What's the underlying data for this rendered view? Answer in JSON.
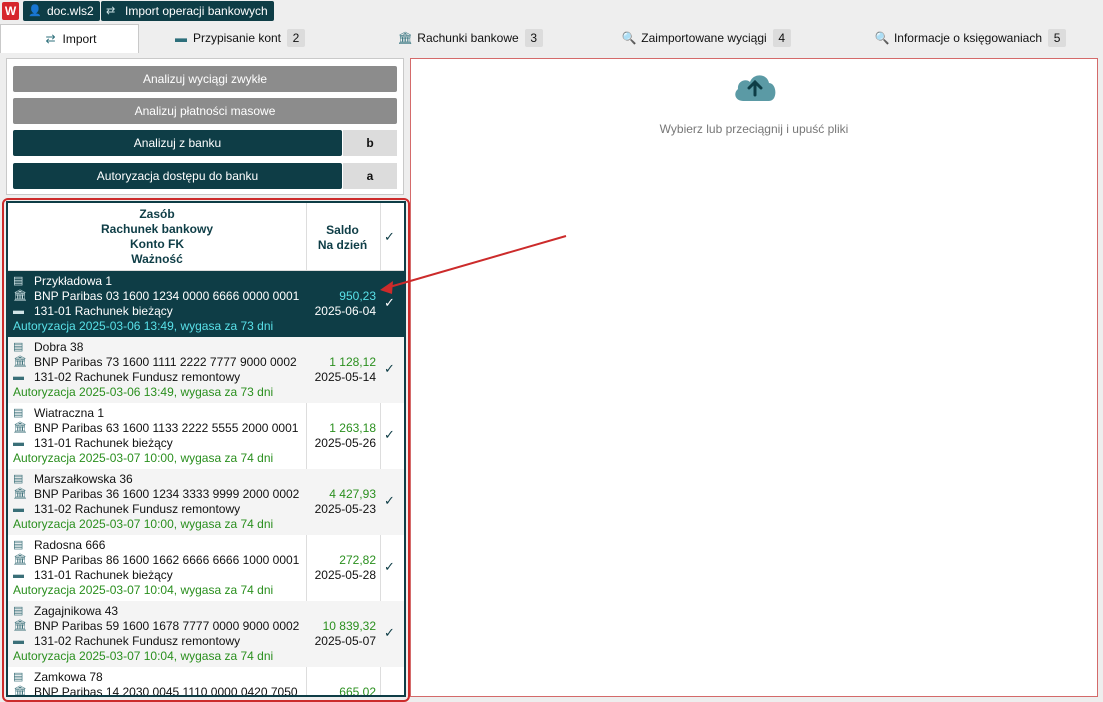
{
  "titlebar": {
    "doc": "doc.wls2",
    "module": "Import operacji bankowych"
  },
  "tabs": [
    {
      "label": "Import",
      "num": ""
    },
    {
      "label": "Przypisanie kont",
      "num": "2"
    },
    {
      "label": "Rachunki bankowe",
      "num": "3"
    },
    {
      "label": "Zaimportowane wyciągi",
      "num": "4"
    },
    {
      "label": "Informacje o księgowaniach",
      "num": "5"
    }
  ],
  "buttons": {
    "analyze_normal": "Analizuj wyciągi zwykłe",
    "analyze_mass": "Analizuj płatności masowe",
    "analyze_bank": "Analizuj z banku",
    "analyze_bank_key": "b",
    "authorize": "Autoryzacja dostępu do banku",
    "authorize_key": "a"
  },
  "dropzone": {
    "text": "Wybierz lub przeciągnij i upuść pliki"
  },
  "table": {
    "headers": {
      "col1": [
        "Zasób",
        "Rachunek bankowy",
        "Konto FK",
        "Ważność"
      ],
      "col2": [
        "Saldo",
        "Na dzień"
      ],
      "col3": "✓"
    },
    "rows": [
      {
        "name": "Przykładowa 1",
        "bank": "BNP Paribas 03 1600 1234 0000 6666 0000 0001",
        "account": "131-01 Rachunek bieżący",
        "auth": "Autoryzacja 2025-03-06 13:49, wygasa za 73 dni",
        "amount": "950,23",
        "date": "2025-06-04",
        "check": "✓"
      },
      {
        "name": "Dobra 38",
        "bank": "BNP Paribas 73 1600 1111 2222 7777 9000 0002",
        "account": "131-02 Rachunek Fundusz remontowy",
        "auth": "Autoryzacja 2025-03-06 13:49, wygasa za 73 dni",
        "amount": "1 128,12",
        "date": "2025-05-14",
        "check": "✓"
      },
      {
        "name": "Wiatraczna 1",
        "bank": "BNP Paribas 63 1600 1133 2222 5555 2000 0001",
        "account": "131-01 Rachunek bieżący",
        "auth": "Autoryzacja 2025-03-07 10:00, wygasa za 74 dni",
        "amount": "1 263,18",
        "date": "2025-05-26",
        "check": "✓"
      },
      {
        "name": "Marszałkowska 36",
        "bank": "BNP Paribas 36 1600 1234 3333 9999 2000 0002",
        "account": "131-02 Rachunek Fundusz remontowy",
        "auth": "Autoryzacja 2025-03-07 10:00, wygasa za 74 dni",
        "amount": "4 427,93",
        "date": "2025-05-23",
        "check": "✓"
      },
      {
        "name": "Radosna 666",
        "bank": "BNP Paribas 86 1600 1662 6666 6666 1000 0001",
        "account": "131-01 Rachunek bieżący",
        "auth": "Autoryzacja 2025-03-07 10:04, wygasa za 74 dni",
        "amount": "272,82",
        "date": "2025-05-28",
        "check": "✓"
      },
      {
        "name": "Zagajnikowa 43",
        "bank": "BNP Paribas 59 1600 1678 7777 0000 9000 0002",
        "account": "131-02 Rachunek Fundusz remontowy",
        "auth": "Autoryzacja 2025-03-07 10:04, wygasa za 74 dni",
        "amount": "10 839,32",
        "date": "2025-05-07",
        "check": "✓"
      },
      {
        "name": "Zamkowa 78",
        "bank": "BNP Paribas 14 2030 0045 1110 0000 0420 7050",
        "account": "",
        "auth": "",
        "amount": "665,02",
        "date": "",
        "check": ""
      }
    ]
  },
  "colors": {
    "accent": "#0e3d46",
    "green": "#2a8f1e",
    "cyan": "#59e0e8",
    "red": "#cc2b2b"
  }
}
